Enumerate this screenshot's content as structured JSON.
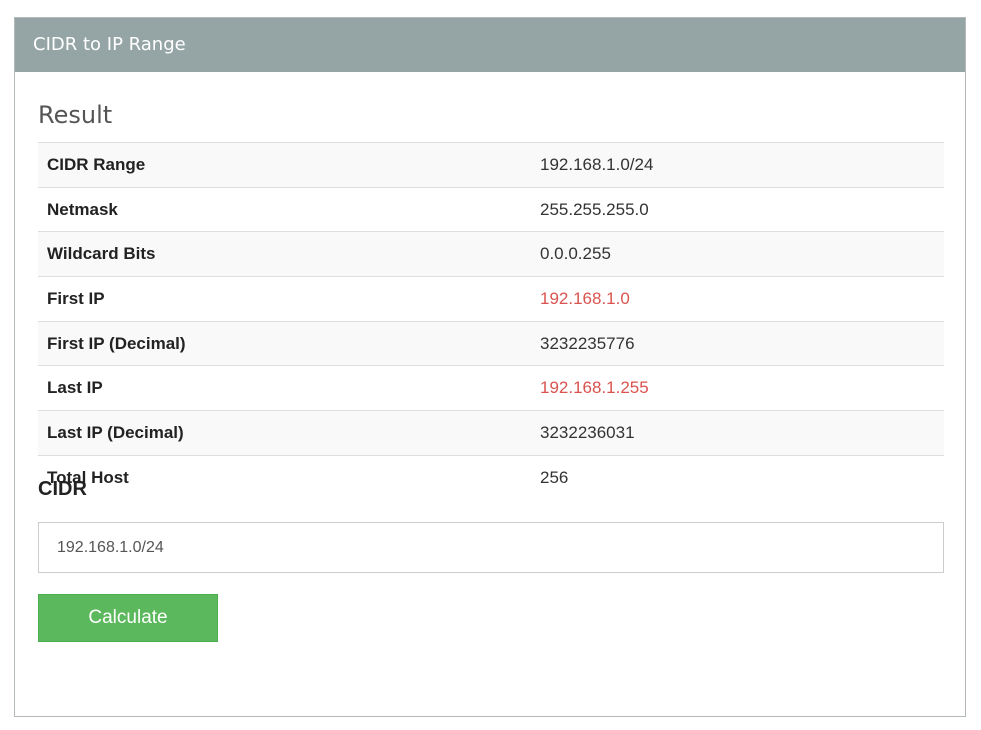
{
  "panel": {
    "title": "CIDR to IP Range"
  },
  "result": {
    "heading": "Result",
    "rows": [
      {
        "label": "CIDR Range",
        "value": "192.168.1.0/24"
      },
      {
        "label": "Netmask",
        "value": "255.255.255.0"
      },
      {
        "label": "Wildcard Bits",
        "value": "0.0.0.255"
      },
      {
        "label": "First IP",
        "value": "192.168.1.0"
      },
      {
        "label": "First IP (Decimal)",
        "value": "3232235776"
      },
      {
        "label": "Last IP",
        "value": "192.168.1.255"
      },
      {
        "label": "Last IP (Decimal)",
        "value": "3232236031"
      },
      {
        "label": "Total Host",
        "value": "256"
      }
    ],
    "highlight_color": "#d9534f"
  },
  "form": {
    "cidr_label": "CIDR",
    "cidr_value": "192.168.1.0/24",
    "button_label": "Calculate",
    "button_color": "#5cb85c"
  },
  "colors": {
    "header_bg": "#95a5a6"
  }
}
